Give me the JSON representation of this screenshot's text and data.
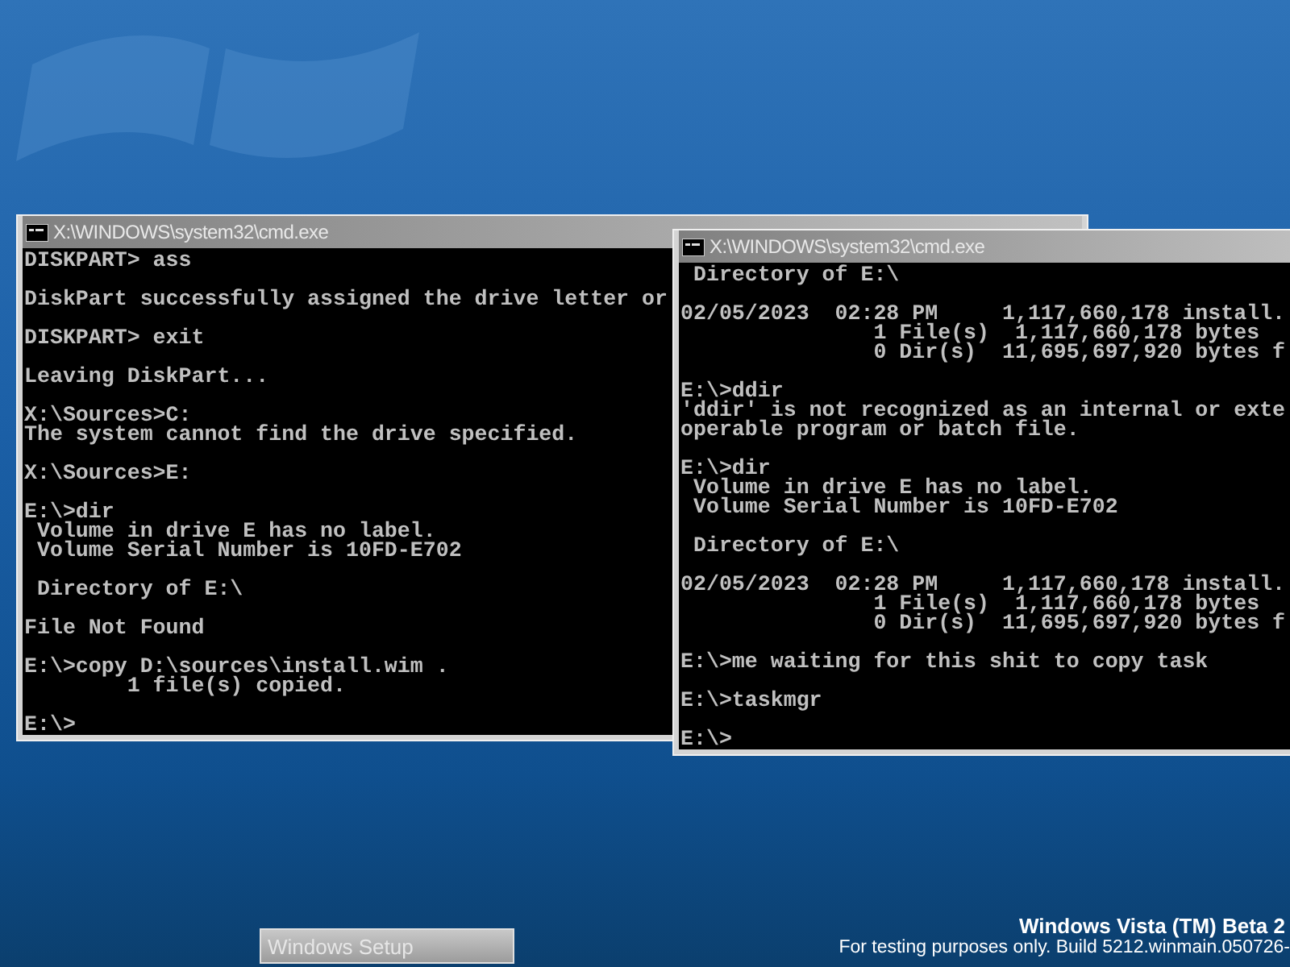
{
  "windows": [
    {
      "title": "X:\\WINDOWS\\system32\\cmd.exe",
      "blocks": [
        [
          "DISKPART> ass"
        ],
        [
          "DiskPart successfully assigned the drive letter or"
        ],
        [
          "DISKPART> exit"
        ],
        [
          "Leaving DiskPart..."
        ],
        [
          "X:\\Sources>C:",
          "The system cannot find the drive specified."
        ],
        [
          "X:\\Sources>E:"
        ],
        [
          "E:\\>dir",
          " Volume in drive E has no label.",
          " Volume Serial Number is 10FD-E702"
        ],
        [
          " Directory of E:\\"
        ],
        [
          "File Not Found"
        ],
        [
          "E:\\>copy D:\\sources\\install.wim .",
          "        1 file(s) copied."
        ],
        [
          "E:\\>"
        ]
      ]
    },
    {
      "title": "X:\\WINDOWS\\system32\\cmd.exe",
      "blocks": [
        [
          " Directory of E:\\"
        ],
        [
          "02/05/2023  02:28 PM     1,117,660,178 install.",
          "               1 File(s)  1,117,660,178 bytes",
          "               0 Dir(s)  11,695,697,920 bytes f"
        ],
        [
          "E:\\>ddir",
          "'ddir' is not recognized as an internal or exte",
          "operable program or batch file."
        ],
        [
          "E:\\>dir",
          " Volume in drive E has no label.",
          " Volume Serial Number is 10FD-E702"
        ],
        [
          " Directory of E:\\"
        ],
        [
          "02/05/2023  02:28 PM     1,117,660,178 install.",
          "               1 File(s)  1,117,660,178 bytes",
          "               0 Dir(s)  11,695,697,920 bytes f"
        ],
        [
          "E:\\>me waiting for this shit to copy task"
        ],
        [
          "E:\\>taskmgr"
        ],
        [
          "E:\\>"
        ]
      ]
    }
  ],
  "taskbar": {
    "button": "Windows Setup"
  },
  "build_info": {
    "title": "Windows Vista (TM) Beta 2",
    "subtitle": "For testing purposes only. Build 5212.winmain.050726-"
  }
}
